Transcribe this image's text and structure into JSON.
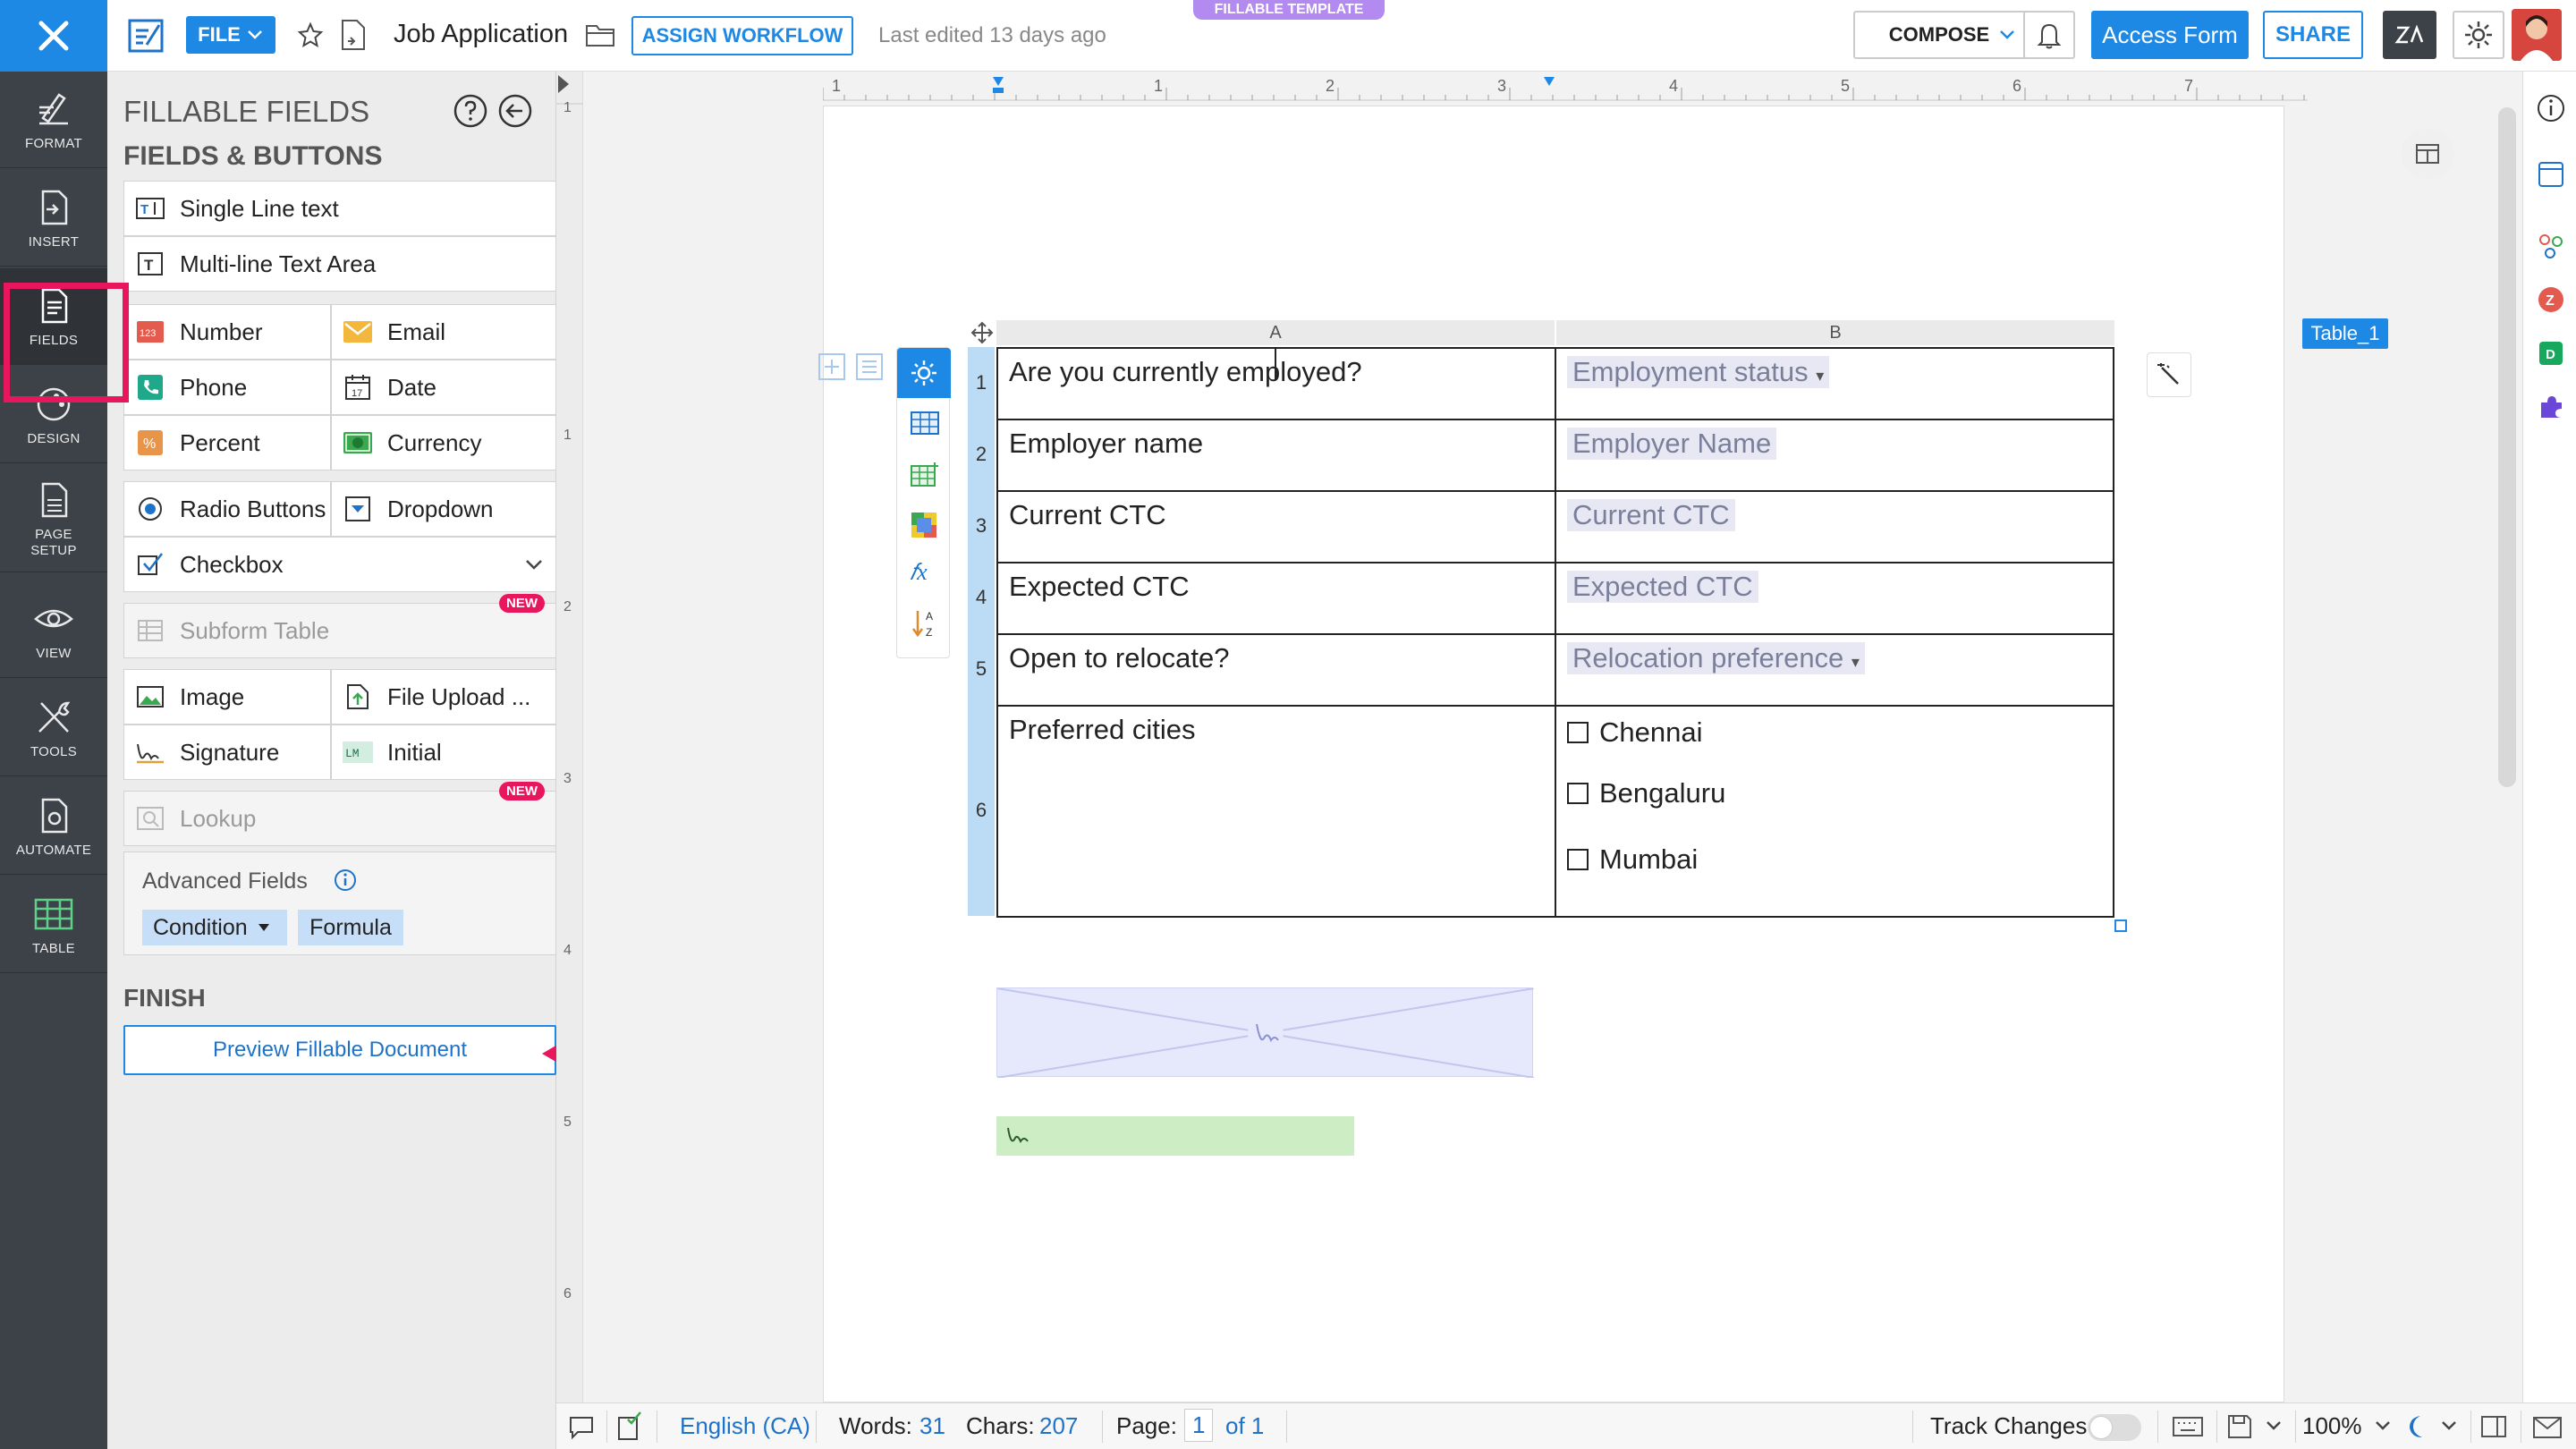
{
  "app": {
    "badge": "FILLABLE TEMPLATE",
    "doc_title": "Job Application",
    "last_edited": "Last edited 13 days ago",
    "file_label": "FILE",
    "assign_workflow": "ASSIGN WORKFLOW",
    "compose_label": "COMPOSE",
    "access_form": "Access Form",
    "share": "SHARE"
  },
  "rail": {
    "items": [
      {
        "label": "FORMAT",
        "icon": "format-icon"
      },
      {
        "label": "INSERT",
        "icon": "insert-icon"
      },
      {
        "label": "FIELDS",
        "icon": "fields-icon"
      },
      {
        "label": "DESIGN",
        "icon": "design-icon"
      },
      {
        "label": "PAGE",
        "label2": "SETUP",
        "icon": "page-setup-icon"
      },
      {
        "label": "VIEW",
        "icon": "view-icon"
      },
      {
        "label": "TOOLS",
        "icon": "tools-icon"
      },
      {
        "label": "AUTOMATE",
        "icon": "automate-icon"
      },
      {
        "label": "TABLE",
        "icon": "table-icon"
      }
    ]
  },
  "panel": {
    "title": "FILLABLE FIELDS",
    "section": "FIELDS & BUTTONS",
    "fields": {
      "single_line": "Single Line text",
      "multi_line": "Multi-line Text Area",
      "number": "Number",
      "email": "Email",
      "phone": "Phone",
      "date": "Date",
      "percent": "Percent",
      "currency": "Currency",
      "radio": "Radio Buttons",
      "dropdown": "Dropdown",
      "checkbox": "Checkbox",
      "subform": "Subform Table",
      "image": "Image",
      "file_upload": "File Upload ...",
      "signature": "Signature",
      "initial": "Initial",
      "lookup": "Lookup"
    },
    "new_badge": "NEW",
    "advanced": {
      "title": "Advanced Fields",
      "condition": "Condition",
      "formula": "Formula"
    },
    "finish": {
      "title": "FINISH",
      "preview": "Preview Fillable Document"
    }
  },
  "ruler": {
    "h_labels": [
      "1",
      "1",
      "2",
      "3",
      "4",
      "5",
      "6",
      "7"
    ],
    "v_labels": [
      "1",
      "1",
      "2",
      "3",
      "4",
      "5",
      "6"
    ]
  },
  "table": {
    "name": "Table_1",
    "col_headers": [
      "A",
      "B"
    ],
    "rows": [
      {
        "num": "1",
        "label": "Are you currently employed?",
        "field": "Employment status",
        "dropdown": true
      },
      {
        "num": "2",
        "label": "Employer name",
        "field": "Employer Name",
        "dropdown": false
      },
      {
        "num": "3",
        "label": "Current CTC",
        "field": "Current CTC",
        "dropdown": false
      },
      {
        "num": "4",
        "label": "Expected CTC",
        "field": "Expected CTC",
        "dropdown": false
      },
      {
        "num": "5",
        "label": "Open to relocate?",
        "field": "Relocation preference",
        "dropdown": true
      },
      {
        "num": "6",
        "label": "Preferred cities",
        "options": [
          "Chennai",
          "Bengaluru",
          "Mumbai"
        ]
      }
    ]
  },
  "status": {
    "language": "English (CA)",
    "words_label": "Words:",
    "words": "31",
    "chars_label": "Chars:",
    "chars": "207",
    "page_label": "Page:",
    "page": "1",
    "of_page": "of 1",
    "track_changes": "Track Changes",
    "zoom": "100%"
  },
  "colors": {
    "accent": "#1e88e5",
    "highlight": "#e8175d",
    "rail": "#3d4248"
  }
}
